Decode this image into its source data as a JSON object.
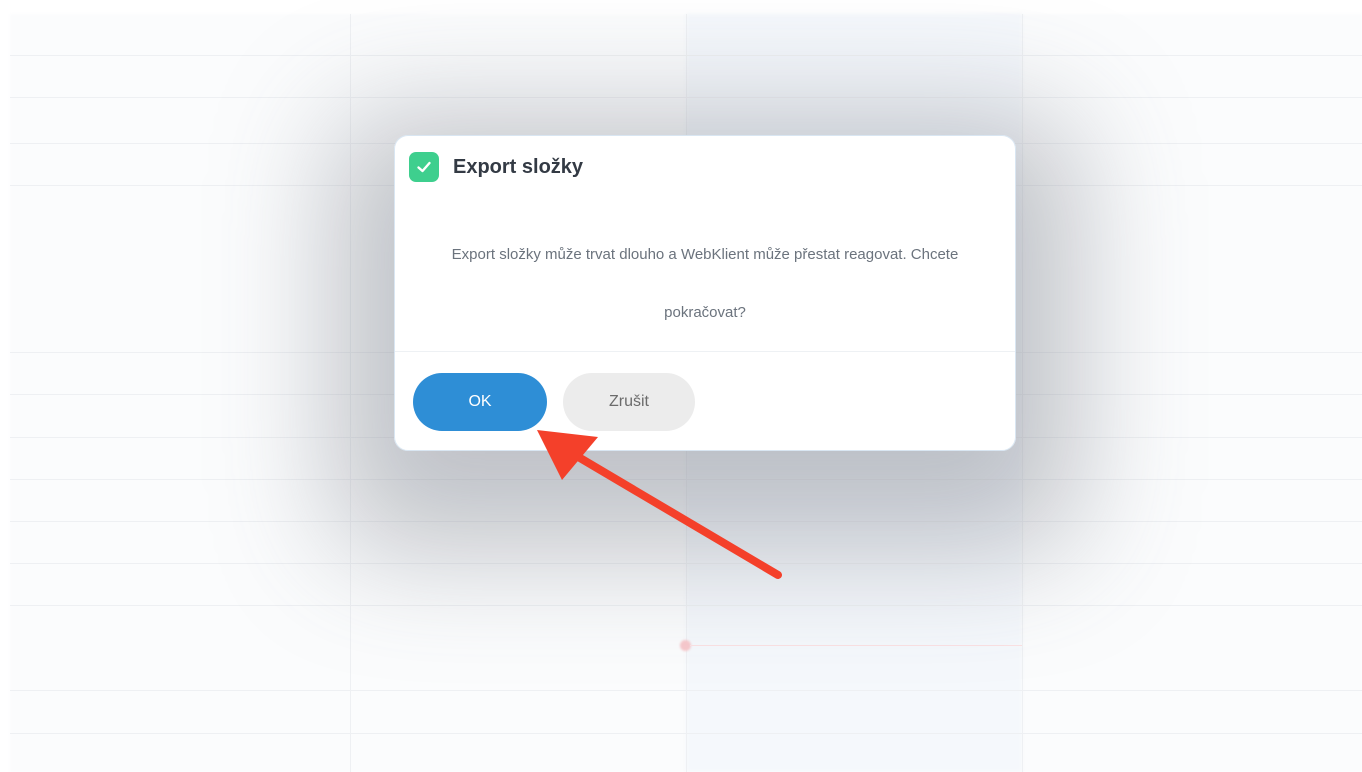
{
  "dialog": {
    "title": "Export složky",
    "message": "Export složky může trvat dlouho a WebKlient může přestat reagovat. Chcete pokračovat?",
    "ok_label": "OK",
    "cancel_label": "Zrušit",
    "icon": "checkmark-icon"
  },
  "annotation": {
    "type": "arrow",
    "color": "#f4402a",
    "points_to": "ok-button"
  },
  "colors": {
    "ok_button": "#2e8ed6",
    "cancel_button": "#ececec",
    "check_badge": "#3ecf8e",
    "arrow": "#f4402a"
  }
}
